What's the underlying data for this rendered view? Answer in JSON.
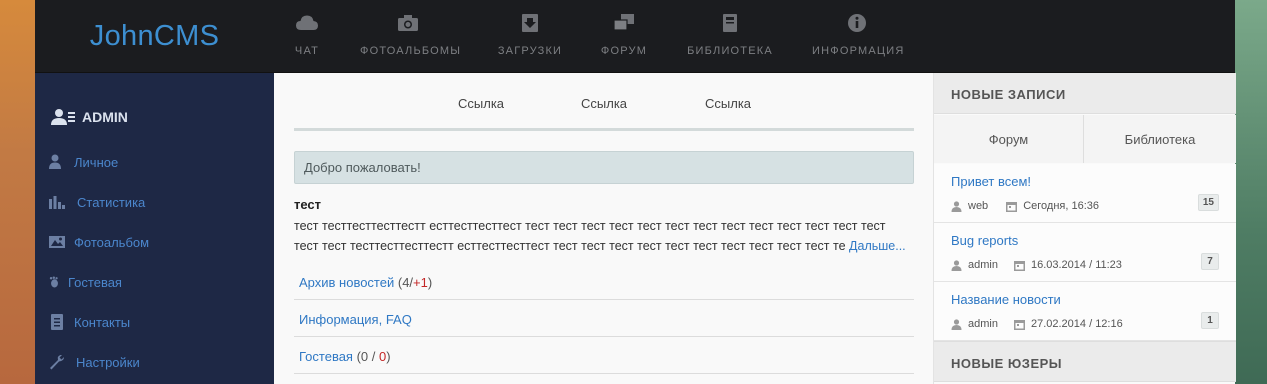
{
  "brand": "JohnCMS",
  "nav": [
    {
      "label": "ЧАТ",
      "icon": "cloud-icon"
    },
    {
      "label": "ФОТОАЛЬБОМЫ",
      "icon": "camera-icon"
    },
    {
      "label": "ЗАГРУЗКИ",
      "icon": "download-icon"
    },
    {
      "label": "ФОРУМ",
      "icon": "comments-icon"
    },
    {
      "label": "БИБЛИОТЕКА",
      "icon": "book-icon"
    },
    {
      "label": "ИНФОРМАЦИЯ",
      "icon": "info-icon"
    }
  ],
  "sidebar": {
    "user": "ADMIN",
    "items": [
      {
        "label": "Личное",
        "icon": "user-icon"
      },
      {
        "label": "Статистика",
        "icon": "bar-chart-icon"
      },
      {
        "label": "Фотоальбом",
        "icon": "picture-icon"
      },
      {
        "label": "Гостевая",
        "icon": "footprint-icon"
      },
      {
        "label": "Контакты",
        "icon": "contacts-icon"
      },
      {
        "label": "Настройки",
        "icon": "wrench-icon"
      }
    ]
  },
  "main": {
    "tabs": [
      "Ссылка",
      "Ссылка",
      "Ссылка"
    ],
    "welcome": "Добро пожаловать!",
    "news": {
      "title": "тест",
      "body_line1": "тест тесттесттесттестт ecттесттесттест тест тест тест тест тест тест тест тест тест тест тест тест тест",
      "body_line2": "тест тест тесттесттесттестт ecттесттесттест тест тест тест тест тест тест тест тест тест тест те",
      "more": "Дальше..."
    },
    "links": [
      {
        "label": "Архив новостей",
        "open": " (",
        "a": "4",
        "sep": "/",
        "b": "+1",
        "close": ")"
      },
      {
        "label": "Информация, FAQ"
      },
      {
        "label": "Гостевая",
        "open": " (",
        "a": "0",
        "sep": " / ",
        "b": "0",
        "close": ")"
      }
    ]
  },
  "right": {
    "heading_posts": "НОВЫЕ ЗАПИСИ",
    "tabs": [
      "Форум",
      "Библиотека"
    ],
    "posts": [
      {
        "title": "Привет всем!",
        "author": "web",
        "date": "Сегодня, 16:36",
        "count": "15"
      },
      {
        "title": "Bug reports",
        "author": "admin",
        "date": "16.03.2014 / 11:23",
        "count": "7"
      },
      {
        "title": "Название новости",
        "author": "admin",
        "date": "27.02.2014 / 12:16",
        "count": "1"
      }
    ],
    "heading_users": "НОВЫЕ ЮЗЕРЫ"
  },
  "colors": {
    "accent": "#2f78c4",
    "topbar": "#1b1c1f",
    "sidebar": "#1e2845",
    "red": "#c32626"
  }
}
